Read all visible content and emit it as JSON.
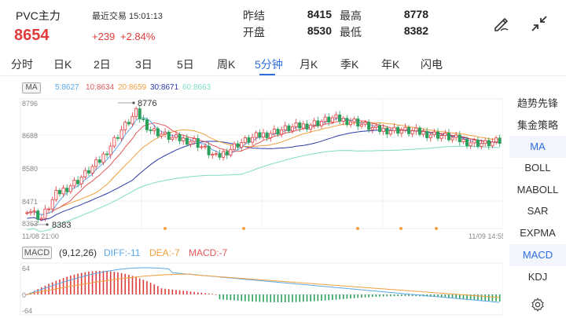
{
  "header": {
    "title": "PVC主力",
    "last_trade_label": "最近交易 15:01:13",
    "price": "8654",
    "change": "+239",
    "change_pct": "+2.84%",
    "stats": {
      "prev_settle_label": "昨结",
      "prev_settle_value": "8415",
      "high_label": "最高",
      "high_value": "8778",
      "open_label": "开盘",
      "open_value": "8530",
      "low_label": "最低",
      "low_value": "8382"
    }
  },
  "tabs": [
    {
      "label": "分时"
    },
    {
      "label": "日K"
    },
    {
      "label": "2日"
    },
    {
      "label": "3日"
    },
    {
      "label": "5日"
    },
    {
      "label": "周K"
    },
    {
      "label": "5分钟",
      "active": true
    },
    {
      "label": "月K"
    },
    {
      "label": "季K"
    },
    {
      "label": "年K"
    },
    {
      "label": "闪电"
    }
  ],
  "ma": {
    "tag": "MA",
    "ma5": "5:8627",
    "ma10": "10:8634",
    "ma20": "20:8659",
    "ma30": "30:8671",
    "ma60": "60:8663",
    "colors": {
      "ma5": "#5aa7e6",
      "ma10": "#e05a5a",
      "ma20": "#f0a040",
      "ma30": "#2c3aa8",
      "ma60": "#7fdcc8"
    }
  },
  "price_axis": {
    "top": "8796",
    "mid1": "8688",
    "mid2": "8580",
    "mid3": "8471",
    "bottom": "8363"
  },
  "annotations": {
    "high_mark": "8776",
    "low_mark": "8383"
  },
  "time_axis": {
    "start": "11/08 21:00",
    "end": "11/09 14:55"
  },
  "macd": {
    "tag": "MACD",
    "params": "(9,12,26)",
    "diff": "DIFF:-11",
    "dea": "DEA:-7",
    "macd": "MACD:-7",
    "axis_top": "64",
    "axis_mid": "0",
    "axis_bottom": "-64"
  },
  "sidebar": {
    "items": [
      {
        "label": "趋势先锋"
      },
      {
        "label": "集金策略"
      },
      {
        "label": "MA",
        "active": true
      },
      {
        "label": "BOLL"
      },
      {
        "label": "MABOLL"
      },
      {
        "label": "SAR"
      },
      {
        "label": "EXPMA"
      },
      {
        "label": "MACD",
        "active": true
      },
      {
        "label": "KDJ"
      }
    ]
  },
  "colors": {
    "up": "#e03b3b",
    "down": "#2aa05a",
    "accent": "#2d6de0"
  },
  "icons": {
    "edit": "pencil-edit-icon",
    "shrink": "collapse-arrows-icon",
    "settings": "gear-icon"
  }
}
